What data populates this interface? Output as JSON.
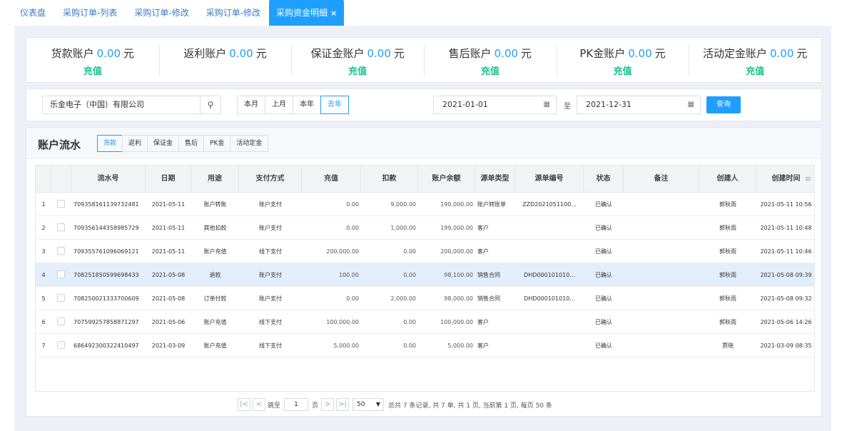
{
  "tabs": [
    {
      "label": "仪表盘"
    },
    {
      "label": "采购订单-列表"
    },
    {
      "label": "采购订单-修改"
    },
    {
      "label": "采购订单-修改"
    },
    {
      "label": "采购资金明细",
      "close": "×"
    }
  ],
  "accounts": [
    {
      "name": "货款账户",
      "amount": "0.00",
      "unit": "元",
      "action": "充值"
    },
    {
      "name": "返利账户",
      "amount": "0.00",
      "unit": "元",
      "action": ""
    },
    {
      "name": "保证金账户",
      "amount": "0.00",
      "unit": "元",
      "action": "充值"
    },
    {
      "name": "售后账户",
      "amount": "0.00",
      "unit": "元",
      "action": "充值"
    },
    {
      "name": "PK金账户",
      "amount": "0.00",
      "unit": "元",
      "action": "充值"
    },
    {
      "name": "活动定金账户",
      "amount": "0.00",
      "unit": "元",
      "action": "充值"
    }
  ],
  "filter": {
    "company": "乐金电子（中国）有限公司",
    "search_icon": "search-icon",
    "periods": [
      "本月",
      "上月",
      "本年",
      "去年"
    ],
    "active_period": 3,
    "start_date": "2021-01-01",
    "to_label": "至",
    "end_date": "2021-12-31",
    "calendar_icon": "calendar-icon",
    "query": "查询"
  },
  "flow": {
    "title": "账户流水",
    "types": [
      "货款",
      "返利",
      "保证金",
      "售后",
      "PK金",
      "活动定金"
    ],
    "active_type": 0
  },
  "table": {
    "columns": [
      "",
      "",
      "流水号",
      "日期",
      "用途",
      "支付方式",
      "充值",
      "扣款",
      "账户余额",
      "源单类型",
      "源单编号",
      "状态",
      "备注",
      "创建人",
      "创建时间"
    ],
    "menu_icon": "≡",
    "rows": [
      {
        "idx": "1",
        "serial": "709358161139732481",
        "date": "2021-05-11",
        "purpose": "账户转账",
        "pay": "账户支付",
        "recharge": "0.00",
        "deduct": "9,000.00",
        "balance": "190,000.00",
        "src_type": "账户转账单",
        "src_no": "ZZD2021051100...",
        "status": "已确认",
        "remark": "",
        "creator": "郭秋雨",
        "created": "2021-05-11 10:56"
      },
      {
        "idx": "2",
        "serial": "709356144358985729",
        "date": "2021-05-11",
        "purpose": "其他扣款",
        "pay": "账户支付",
        "recharge": "0.00",
        "deduct": "1,000.00",
        "balance": "199,000.00",
        "src_type": "客户",
        "src_no": "",
        "status": "已确认",
        "remark": "",
        "creator": "郭秋雨",
        "created": "2021-05-11 10:48"
      },
      {
        "idx": "3",
        "serial": "709355761096069121",
        "date": "2021-05-11",
        "purpose": "账户充值",
        "pay": "线下支付",
        "recharge": "200,000.00",
        "deduct": "0.00",
        "balance": "200,000.00",
        "src_type": "客户",
        "src_no": "",
        "status": "已确认",
        "remark": "",
        "creator": "郭秋雨",
        "created": "2021-05-11 10:46"
      },
      {
        "idx": "4",
        "serial": "708251850599698433",
        "date": "2021-05-08",
        "purpose": "退款",
        "pay": "账户支付",
        "recharge": "100.00",
        "deduct": "0.00",
        "balance": "98,100.00",
        "src_type": "销售合同",
        "src_no": "DHD000101010...",
        "status": "已确认",
        "remark": "",
        "creator": "郭秋雨",
        "created": "2021-05-08 09:39"
      },
      {
        "idx": "5",
        "serial": "708250021333700609",
        "date": "2021-05-08",
        "purpose": "订单付款",
        "pay": "账户支付",
        "recharge": "0.00",
        "deduct": "2,000.00",
        "balance": "98,000.00",
        "src_type": "销售合同",
        "src_no": "DHD000101010...",
        "status": "已确认",
        "remark": "",
        "creator": "郭秋雨",
        "created": "2021-05-08 09:32"
      },
      {
        "idx": "6",
        "serial": "707599257858871297",
        "date": "2021-05-06",
        "purpose": "账户充值",
        "pay": "线下支付",
        "recharge": "100,000.00",
        "deduct": "0.00",
        "balance": "100,000.00",
        "src_type": "客户",
        "src_no": "",
        "status": "已确认",
        "remark": "",
        "creator": "郭秋雨",
        "created": "2021-05-06 14:26"
      },
      {
        "idx": "7",
        "serial": "686492300322410497",
        "date": "2021-03-09",
        "purpose": "账户充值",
        "pay": "线下支付",
        "recharge": "5,000.00",
        "deduct": "0.00",
        "balance": "5,000.00",
        "src_type": "客户",
        "src_no": "",
        "status": "已确认",
        "remark": "",
        "creator": "贾晓",
        "created": "2021-03-09 08:35"
      }
    ],
    "selected_row": 3
  },
  "pager": {
    "first": "|<",
    "prev": "<",
    "goto_label": "跳至",
    "page": "1",
    "page_unit": "页",
    "next": ">",
    "last": ">|",
    "page_size": "50",
    "summary": "总共 7 条记录, 共 7 单, 共 1 页, 当前第 1 页, 每页 50 条"
  }
}
